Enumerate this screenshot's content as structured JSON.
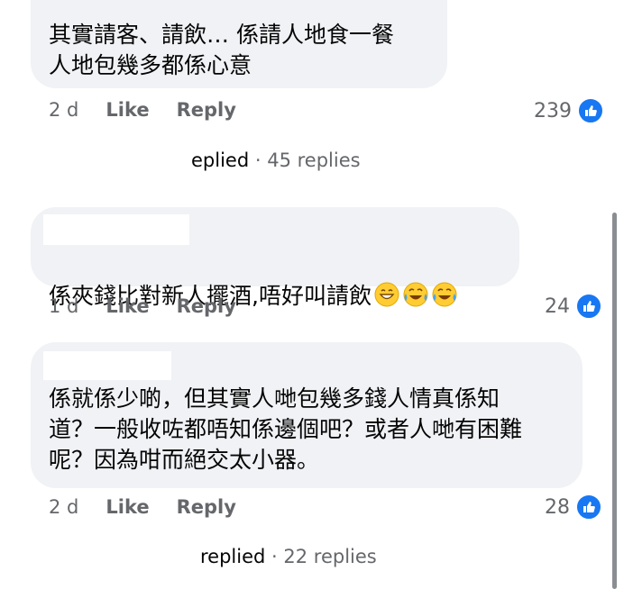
{
  "comments": [
    {
      "text": "其實請客、請飲… 係請人地食一餐\n人地包幾多都係心意",
      "time": "2 d",
      "like_label": "Like",
      "reply_label": "Reply",
      "reaction_count": "239"
    },
    {
      "text": "係夾錢比對新人擺酒,唔好叫請飲",
      "emojis": [
        "grinning-face",
        "face-with-tears-of-joy",
        "face-with-tears-of-joy"
      ],
      "time": "1 d",
      "like_label": "Like",
      "reply_label": "Reply",
      "reaction_count": "24"
    },
    {
      "text": "係就係少啲，但其實人哋包幾多錢人情真係知\n道？一般收咗都唔知係邊個吧？或者人哋有困難\n呢？因為咁而絕交太小器。",
      "time": "2 d",
      "like_label": "Like",
      "reply_label": "Reply",
      "reaction_count": "28"
    }
  ],
  "reply_threads": [
    {
      "who": "eplied",
      "separator": " · ",
      "count": "45 replies"
    },
    {
      "who": "replied",
      "separator": " · ",
      "count": "22 replies"
    }
  ],
  "colors": {
    "bubble": "#f0f2f5",
    "meta": "#65676b",
    "like_blue": "#1877f2",
    "text": "#050505"
  },
  "icons": {
    "reaction": "thumbs-up-icon"
  }
}
